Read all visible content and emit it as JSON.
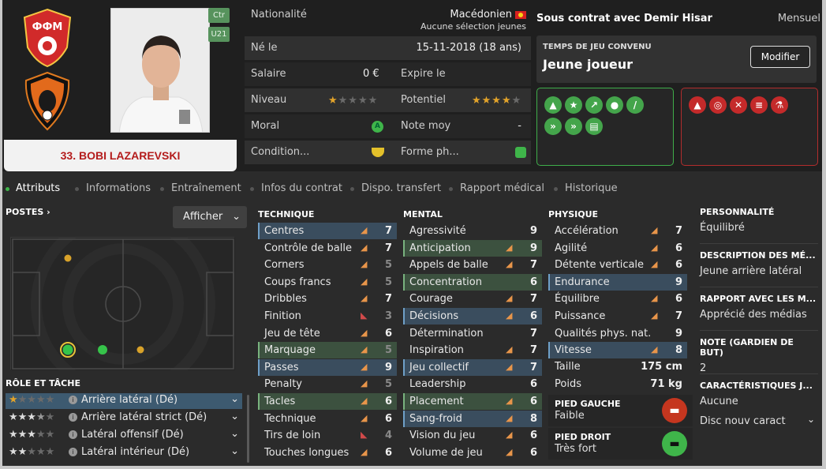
{
  "player": {
    "name": "33. BOBI LAZAREVSKI",
    "positions": [
      "Ctr",
      "U21"
    ]
  },
  "info": {
    "nationality_label": "Nationalité",
    "nationality": "Macédonien",
    "selection": "Aucune sélection jeunes",
    "born_label": "Né le",
    "born": "15-11-2018 (18 ans)",
    "salary_label": "Salaire",
    "salary": "0 €",
    "expires_label": "Expire le",
    "expires": "",
    "level_label": "Niveau",
    "level_stars": 1,
    "potential_label": "Potentiel",
    "potential_stars": 4,
    "morale_label": "Moral",
    "avg_label": "Note moy",
    "avg": "-",
    "condition_label": "Condition...",
    "form_label": "Forme ph..."
  },
  "contract": {
    "status": "Sous contrat avec Demir Hisar",
    "period": "Mensuel",
    "playtime_title": "TEMPS DE JEU CONVENU",
    "playtime": "Jeune joueur",
    "modify": "Modifier"
  },
  "tabs": [
    "Attributs",
    "Informations",
    "Entraînement",
    "Infos du contrat",
    "Dispo. transfert",
    "Rapport médical",
    "Historique"
  ],
  "left": {
    "postes": "POSTES",
    "afficher": "Afficher",
    "role_title": "RÔLE ET TÂCHE",
    "roles": [
      {
        "label": "Arrière latéral (Dé)",
        "stars": 1
      },
      {
        "label": "Arrière latéral strict (Dé)",
        "stars": 3.5
      },
      {
        "label": "Latéral offensif (Dé)",
        "stars": 3
      },
      {
        "label": "Latéral intérieur (Dé)",
        "stars": 2
      }
    ]
  },
  "columns": {
    "technique": "TECHNIQUE",
    "mental": "MENTAL",
    "physique": "PHYSIQUE"
  },
  "technique": [
    {
      "name": "Centres",
      "value": "7",
      "arrow": "up",
      "hl": "b"
    },
    {
      "name": "Contrôle de balle",
      "value": "7",
      "arrow": "up",
      "hl": ""
    },
    {
      "name": "Corners",
      "value": "5",
      "arrow": "up",
      "hl": "",
      "dim": true
    },
    {
      "name": "Coups francs",
      "value": "5",
      "arrow": "up",
      "hl": "",
      "dim": true
    },
    {
      "name": "Dribbles",
      "value": "7",
      "arrow": "up",
      "hl": ""
    },
    {
      "name": "Finition",
      "value": "3",
      "arrow": "down",
      "hl": "",
      "dim": true
    },
    {
      "name": "Jeu de tête",
      "value": "6",
      "arrow": "up",
      "hl": ""
    },
    {
      "name": "Marquage",
      "value": "5",
      "arrow": "up",
      "hl": "g",
      "dim": true
    },
    {
      "name": "Passes",
      "value": "9",
      "arrow": "up",
      "hl": "b"
    },
    {
      "name": "Penalty",
      "value": "5",
      "arrow": "up",
      "hl": "",
      "dim": true
    },
    {
      "name": "Tacles",
      "value": "6",
      "arrow": "up",
      "hl": "g"
    },
    {
      "name": "Technique",
      "value": "6",
      "arrow": "up",
      "hl": ""
    },
    {
      "name": "Tirs de loin",
      "value": "4",
      "arrow": "down",
      "hl": "",
      "dim": true
    },
    {
      "name": "Touches longues",
      "value": "6",
      "arrow": "up",
      "hl": ""
    }
  ],
  "mental": [
    {
      "name": "Agressivité",
      "value": "9",
      "arrow": "",
      "hl": ""
    },
    {
      "name": "Anticipation",
      "value": "9",
      "arrow": "up",
      "hl": "g"
    },
    {
      "name": "Appels de balle",
      "value": "7",
      "arrow": "up",
      "hl": ""
    },
    {
      "name": "Concentration",
      "value": "6",
      "arrow": "",
      "hl": "g"
    },
    {
      "name": "Courage",
      "value": "7",
      "arrow": "up",
      "hl": ""
    },
    {
      "name": "Décisions",
      "value": "6",
      "arrow": "up",
      "hl": "b"
    },
    {
      "name": "Détermination",
      "value": "7",
      "arrow": "",
      "hl": ""
    },
    {
      "name": "Inspiration",
      "value": "7",
      "arrow": "up",
      "hl": ""
    },
    {
      "name": "Jeu collectif",
      "value": "7",
      "arrow": "up",
      "hl": "b"
    },
    {
      "name": "Leadership",
      "value": "6",
      "arrow": "",
      "hl": ""
    },
    {
      "name": "Placement",
      "value": "6",
      "arrow": "up",
      "hl": "g"
    },
    {
      "name": "Sang-froid",
      "value": "8",
      "arrow": "up",
      "hl": "b"
    },
    {
      "name": "Vision du jeu",
      "value": "6",
      "arrow": "up",
      "hl": ""
    },
    {
      "name": "Volume de jeu",
      "value": "6",
      "arrow": "up",
      "hl": ""
    }
  ],
  "physique": [
    {
      "name": "Accélération",
      "value": "7",
      "arrow": "up",
      "hl": ""
    },
    {
      "name": "Agilité",
      "value": "6",
      "arrow": "up",
      "hl": ""
    },
    {
      "name": "Détente verticale",
      "value": "6",
      "arrow": "up",
      "hl": ""
    },
    {
      "name": "Endurance",
      "value": "9",
      "arrow": "",
      "hl": "b"
    },
    {
      "name": "Équilibre",
      "value": "6",
      "arrow": "up",
      "hl": ""
    },
    {
      "name": "Puissance",
      "value": "7",
      "arrow": "up",
      "hl": ""
    },
    {
      "name": "Qualités phys. nat.",
      "value": "9",
      "arrow": "",
      "hl": ""
    },
    {
      "name": "Vitesse",
      "value": "8",
      "arrow": "up",
      "hl": "b"
    }
  ],
  "body": {
    "height_label": "Taille",
    "height": "175 cm",
    "weight_label": "Poids",
    "weight": "71 kg",
    "left_foot_label": "PIED GAUCHE",
    "left_foot": "Faible",
    "right_foot_label": "PIED DROIT",
    "right_foot": "Très fort"
  },
  "right": {
    "personality_label": "PERSONNALITÉ",
    "personality": "Équilibré",
    "description_label": "DESCRIPTION DES MÉ...",
    "description": "Jeune arrière latéral",
    "media_label": "RAPPORT AVEC LES M...",
    "media": "Apprécié des médias",
    "gk_label": "NOTE (GARDIEN DE BUT)",
    "gk": "2",
    "traits_label": "CARACTÉRISTIQUES J...",
    "traits": "Aucune",
    "traits_add": "Disc nouv caract"
  },
  "colors": {
    "bg": "#2b2b2b",
    "accent_blue": "#3a4d5e",
    "accent_green": "#3c513f",
    "name_red": "#b41c1c",
    "star": "#e2a32a"
  }
}
